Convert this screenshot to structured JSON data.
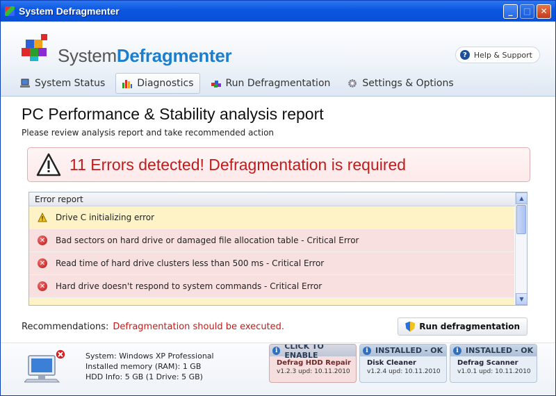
{
  "window": {
    "title": "System Defragmenter"
  },
  "header": {
    "brand_part1": "System",
    "brand_part2": "Defragmenter",
    "help_label": "Help & Support"
  },
  "tabs": [
    {
      "label": "System Status",
      "icon": "laptop-icon",
      "active": false
    },
    {
      "label": "Diagnostics",
      "icon": "bar-chart-icon",
      "active": true
    },
    {
      "label": "Run Defragmentation",
      "icon": "blocks-icon",
      "active": false
    },
    {
      "label": "Settings & Options",
      "icon": "gear-icon",
      "active": false
    }
  ],
  "main": {
    "title": "PC Performance & Stability analysis report",
    "subtitle": "Please review analysis report and take recommended action",
    "alert_message": "11 Errors detected! Defragmentation is required"
  },
  "report": {
    "header": "Error report",
    "rows": [
      {
        "type": "warning",
        "text": "Drive C initializing error"
      },
      {
        "type": "error",
        "text": "Bad sectors on hard drive or damaged file allocation table - Critical Error"
      },
      {
        "type": "error",
        "text": "Read time of hard drive clusters less than 500 ms - Critical Error"
      },
      {
        "type": "error",
        "text": "Hard drive doesn't respond to system commands - Critical Error"
      }
    ]
  },
  "recommendations": {
    "label": "Recommendations:",
    "value": "Defragmentation should be executed.",
    "button_label": "Run defragmentation"
  },
  "system_info": {
    "line1": "System: Windows XP Professional",
    "line2": "Installed memory (RAM): 1 GB",
    "line3": "HDD Info: 5 GB (1 Drive: 5 GB)"
  },
  "cards": [
    {
      "status": "CLICK TO ENABLE",
      "name": "Defrag HDD Repair",
      "version": "v1.2.3 upd: 10.11.2010"
    },
    {
      "status": "INSTALLED - OK",
      "name": "Disk Cleaner",
      "version": "v1.2.4 upd: 10.11.2010"
    },
    {
      "status": "INSTALLED - OK",
      "name": "Defrag Scanner",
      "version": "v1.0.1 upd: 10.11.2010"
    }
  ],
  "colors": {
    "title_bar": "#0a56e0",
    "brand_accent": "#1b7fce",
    "error_text": "#c11b1b",
    "warning_row": "#fdf3c6",
    "error_row": "#f8e0e0"
  }
}
